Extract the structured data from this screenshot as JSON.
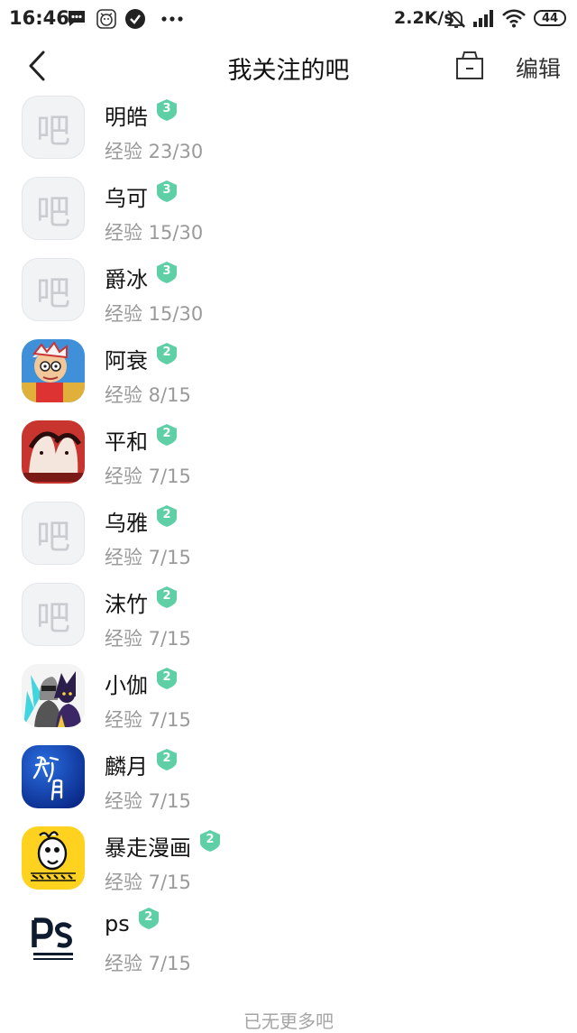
{
  "status_bar": {
    "time": "16:46",
    "net_speed": "2.2K/s",
    "battery": "44",
    "icons": [
      "message-icon",
      "app-notification-icon",
      "check-circle-icon",
      "more-dots-icon",
      "mute-icon",
      "signal-icon",
      "wifi-icon",
      "battery-icon"
    ]
  },
  "header": {
    "title": "我关注的吧",
    "edit_label": "编辑",
    "icons": [
      "back-chevron-icon",
      "tray-icon"
    ]
  },
  "list": {
    "items": [
      {
        "name": "明皓",
        "level": "3",
        "exp": "经验 23/30",
        "avatar": "default",
        "avatar_char": "吧"
      },
      {
        "name": "乌可",
        "level": "3",
        "exp": "经验 15/30",
        "avatar": "default",
        "avatar_char": "吧"
      },
      {
        "name": "爵冰",
        "level": "3",
        "exp": "经验 15/30",
        "avatar": "default",
        "avatar_char": "吧"
      },
      {
        "name": "阿衰",
        "level": "2",
        "exp": "经验 8/15",
        "avatar": "cartoon-boy"
      },
      {
        "name": "平和",
        "level": "2",
        "exp": "经验 7/15",
        "avatar": "red-manga"
      },
      {
        "name": "乌雅",
        "level": "2",
        "exp": "经验 7/15",
        "avatar": "default",
        "avatar_char": "吧"
      },
      {
        "name": "沫竹",
        "level": "2",
        "exp": "经验 7/15",
        "avatar": "default",
        "avatar_char": "吧"
      },
      {
        "name": "小伽",
        "level": "2",
        "exp": "经验 7/15",
        "avatar": "anime-duo"
      },
      {
        "name": "麟月",
        "level": "2",
        "exp": "经验 7/15",
        "avatar": "blue-calligraphy"
      },
      {
        "name": "暴走漫画",
        "level": "2",
        "exp": "经验 7/15",
        "avatar": "rage-comic"
      },
      {
        "name": "ps",
        "level": "2",
        "exp": "经验 7/15",
        "avatar": "photoshop"
      }
    ],
    "level_badge_color": "#5fd0a6"
  },
  "footer": {
    "text": "已无更多吧"
  }
}
